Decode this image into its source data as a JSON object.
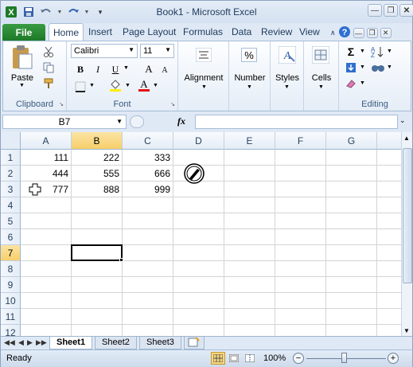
{
  "app": {
    "title": "Book1 - Microsoft Excel",
    "quick_access": {
      "save_icon": "save-icon",
      "undo_icon": "undo-icon",
      "redo_icon": "redo-icon",
      "customize_icon": "customize-qat-icon"
    }
  },
  "ribbon_tabs": [
    "File",
    "Home",
    "Insert",
    "Page Layout",
    "Formulas",
    "Data",
    "Review",
    "View"
  ],
  "ribbon": {
    "clipboard": {
      "paste_label": "Paste",
      "group_label": "Clipboard"
    },
    "font": {
      "font_name": "Calibri",
      "font_size": "11",
      "bold": "B",
      "italic": "I",
      "underline": "U",
      "grow": "A",
      "shrink": "A",
      "font_color_letter": "A",
      "group_label": "Font"
    },
    "alignment": {
      "label": "Alignment"
    },
    "number": {
      "label": "Number",
      "icon_text": "%"
    },
    "styles": {
      "label": "Styles"
    },
    "cells": {
      "label": "Cells"
    },
    "editing": {
      "group_label": "Editing",
      "sigma": "Σ"
    }
  },
  "formula_bar": {
    "name_box": "B7",
    "fx": "fx",
    "formula": ""
  },
  "grid": {
    "columns": [
      "A",
      "B",
      "C",
      "D",
      "E",
      "F",
      "G"
    ],
    "rows": [
      "1",
      "2",
      "3",
      "4",
      "5",
      "6",
      "7",
      "8",
      "9",
      "10",
      "11",
      "12"
    ],
    "selected_column": "B",
    "selected_row": "7",
    "cells": {
      "A1": "111",
      "B1": "222",
      "C1": "333",
      "A2": "444",
      "B2": "555",
      "C2": "666",
      "A3": "777",
      "B3": "888",
      "C3": "999"
    }
  },
  "sheets": [
    "Sheet1",
    "Sheet2",
    "Sheet3"
  ],
  "active_sheet": "Sheet1",
  "status": {
    "ready": "Ready",
    "zoom": "100%"
  },
  "colors": {
    "accent": "#1d7a28",
    "selection_header": "#f7cf6a"
  }
}
